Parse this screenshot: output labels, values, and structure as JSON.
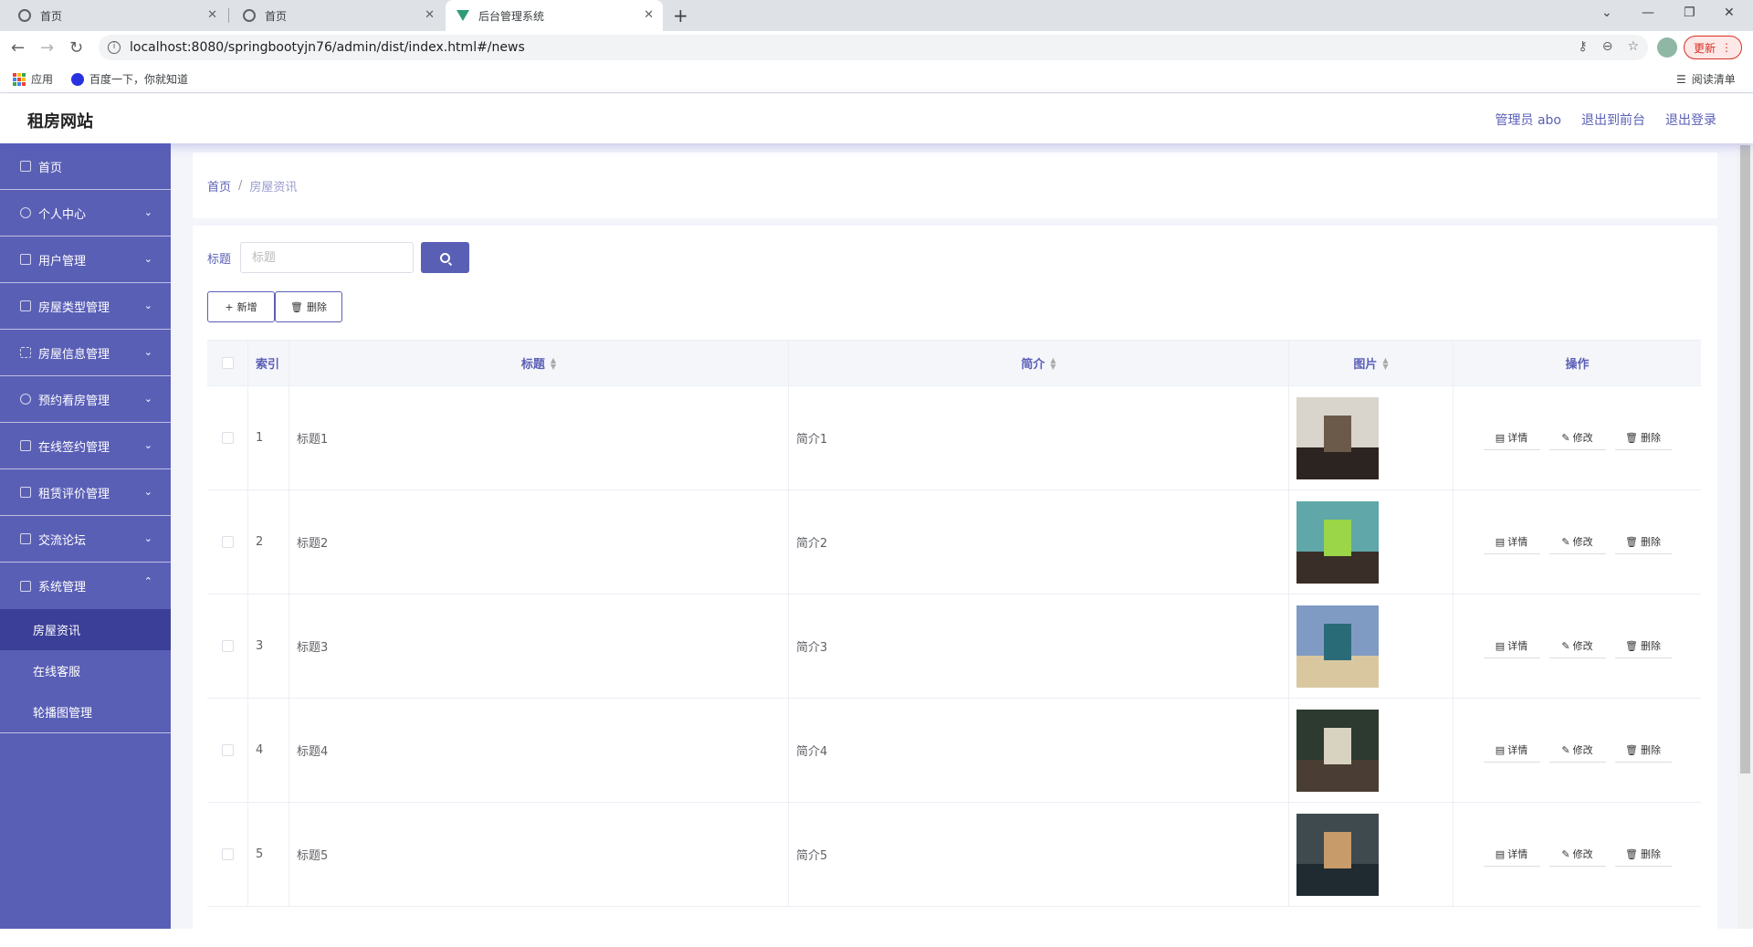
{
  "browser": {
    "tabs": [
      {
        "title": "首页",
        "active": false
      },
      {
        "title": "首页",
        "active": false
      },
      {
        "title": "后台管理系统",
        "active": true
      }
    ],
    "url": "localhost:8080/springbootyjn76/admin/dist/index.html#/news",
    "update_label": "更新",
    "bookmarks": [
      {
        "label": "应用",
        "icon": "apps-grid-icon"
      },
      {
        "label": "百度一下，你就知道",
        "icon": "baidu-paw-icon"
      }
    ],
    "reading_list": "阅读清单"
  },
  "header": {
    "site_title": "租房网站",
    "admin_label": "管理员 abo",
    "to_front": "退出到前台",
    "logout": "退出登录"
  },
  "sidebar": {
    "items": [
      {
        "label": "首页",
        "icon": "home-icon",
        "expandable": false
      },
      {
        "label": "个人中心",
        "icon": "user-icon",
        "expandable": true
      },
      {
        "label": "用户管理",
        "icon": "flag-icon",
        "expandable": true
      },
      {
        "label": "房屋类型管理",
        "icon": "crop-icon",
        "expandable": true
      },
      {
        "label": "房屋信息管理",
        "icon": "fullscreen-icon",
        "expandable": true
      },
      {
        "label": "预约看房管理",
        "icon": "clock-icon",
        "expandable": true
      },
      {
        "label": "在线签约管理",
        "icon": "sliders-icon",
        "expandable": true
      },
      {
        "label": "租赁评价管理",
        "icon": "suitcase-icon",
        "expandable": true
      },
      {
        "label": "交流论坛",
        "icon": "document-icon",
        "expandable": true
      },
      {
        "label": "系统管理",
        "icon": "message-icon",
        "expandable": true,
        "expanded": true
      }
    ],
    "submenu": [
      {
        "label": "房屋资讯",
        "active": true
      },
      {
        "label": "在线客服",
        "active": false
      },
      {
        "label": "轮播图管理",
        "active": false
      }
    ]
  },
  "breadcrumb": {
    "home": "首页",
    "separator": "/",
    "current": "房屋资讯"
  },
  "search": {
    "label": "标题",
    "placeholder": "标题"
  },
  "actions": {
    "add": "新增",
    "delete": "删除"
  },
  "table": {
    "headers": {
      "index": "索引",
      "title": "标题",
      "desc": "简介",
      "image": "图片",
      "ops": "操作"
    },
    "row_actions": {
      "detail": "详情",
      "edit": "修改",
      "delete": "删除"
    },
    "rows": [
      {
        "index": "1",
        "title": "标题1",
        "desc": "简介1"
      },
      {
        "index": "2",
        "title": "标题2",
        "desc": "简介2"
      },
      {
        "index": "3",
        "title": "标题3",
        "desc": "简介3"
      },
      {
        "index": "4",
        "title": "标题4",
        "desc": "简介4"
      },
      {
        "index": "5",
        "title": "标题5",
        "desc": "简介5"
      }
    ]
  },
  "colors": {
    "primary": "#5a5fb6",
    "sidebar_active": "#3b3f98",
    "main_bg": "#f4f5fb"
  }
}
